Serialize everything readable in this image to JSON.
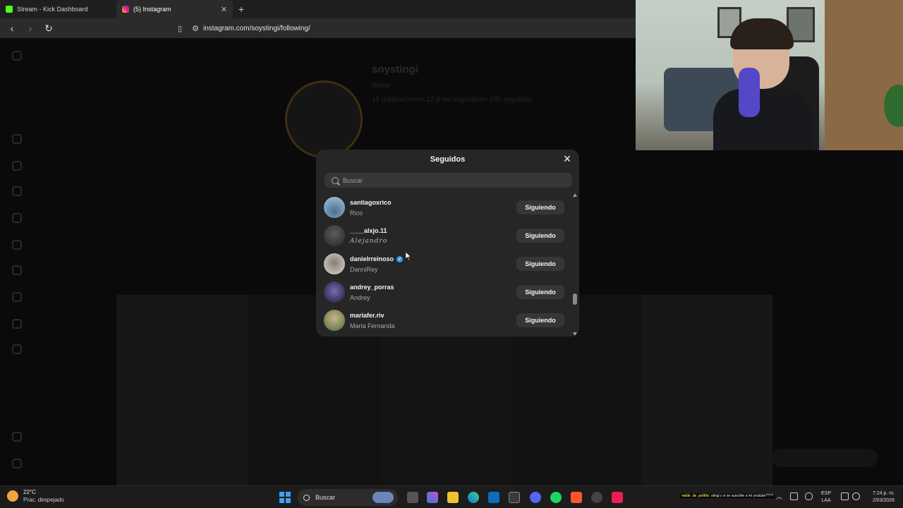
{
  "browser": {
    "tabs": [
      {
        "title": "Stream - Kick Dashboard",
        "favicon": "kick-logo-icon",
        "active": false
      },
      {
        "title": "(5) Instagram",
        "favicon": "instagram-logo-icon",
        "active": true
      }
    ],
    "url": "instagram.com/soystingi/following/"
  },
  "profile_bg": {
    "username": "soystingi",
    "category": "Sleep",
    "stats": "15 publicaciones    12,8 mil seguidores    285 seguidos"
  },
  "modal": {
    "title": "Seguidos",
    "search_placeholder": "Buscar",
    "rows": [
      {
        "username": "santiagoxrico",
        "fullname": "Rico",
        "verified": false,
        "button": "Siguiendo"
      },
      {
        "username": "____alxjo.11",
        "fullname": "Alejandro",
        "verified": false,
        "button": "Siguiendo"
      },
      {
        "username": "danielrreinoso",
        "fullname": "DanniRey",
        "verified": true,
        "button": "Siguiendo"
      },
      {
        "username": "andrey_porras",
        "fullname": "Andrey",
        "verified": false,
        "button": "Siguiendo"
      },
      {
        "username": "mariafer.riv",
        "fullname": "Maria Fernanda",
        "verified": false,
        "button": "Siguiendo"
      }
    ],
    "verified_mark": "✓"
  },
  "taskbar": {
    "weather_temp": "22°C",
    "weather_desc": "Prac. despejado",
    "search_label": "Buscar",
    "lang_line1": "ESP",
    "lang_line2": "LAA",
    "time": "7:24 p. m.",
    "date": "2/03/2026",
    "chat_user": "valde_de_pollito",
    "chat_text": ": stingi y si se suscribe a mi youtube????"
  },
  "colors": {
    "modal_bg": "#262626",
    "button_bg": "#363636",
    "verified": "#3897f0",
    "accent_start": "#3ea0f5"
  }
}
